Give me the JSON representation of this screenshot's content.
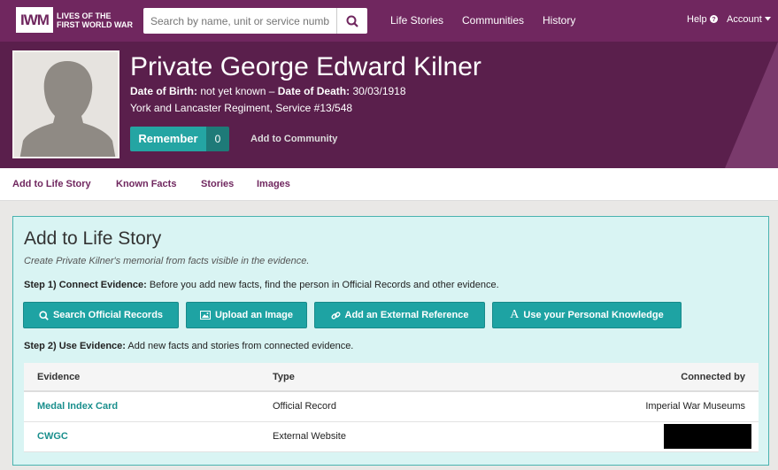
{
  "nav": {
    "logo_mark": "IWM",
    "logo_text": "LIVES OF THE FIRST WORLD WAR",
    "search_placeholder": "Search by name, unit or service number",
    "links": [
      "Life Stories",
      "Communities",
      "History"
    ],
    "help": "Help",
    "account": "Account"
  },
  "profile": {
    "rank": "Private",
    "name": "George Edward Kilner",
    "dob_label": "Date of Birth:",
    "dob_value": "not yet known",
    "dash": "–",
    "dod_label": "Date of Death:",
    "dod_value": "30/03/1918",
    "regiment": "York and Lancaster Regiment, Service #13/548",
    "remember_label": "Remember",
    "remember_count": "0",
    "add_community": "Add to Community"
  },
  "tabs": [
    "Add to Life Story",
    "Known Facts",
    "Stories",
    "Images"
  ],
  "panel": {
    "title": "Add to Life Story",
    "subtitle": "Create Private Kilner's memorial from facts visible in the evidence.",
    "step1_label": "Step 1) Connect Evidence:",
    "step1_text": "Before you add new facts, find the person in Official Records and other evidence.",
    "buttons": [
      {
        "label": "Search Official Records",
        "icon": "search-icon"
      },
      {
        "label": "Upload an Image",
        "icon": "image-icon"
      },
      {
        "label": "Add an External Reference",
        "icon": "link-icon"
      },
      {
        "label": "Use your Personal Knowledge",
        "icon": "font-icon"
      }
    ],
    "step2_label": "Step 2) Use Evidence:",
    "step2_text": "Add new facts and stories from connected evidence."
  },
  "table": {
    "headers": [
      "Evidence",
      "Type",
      "Connected by"
    ],
    "rows": [
      {
        "evidence": "Medal Index Card",
        "type": "Official Record",
        "connected_by": "Imperial War Museums"
      },
      {
        "evidence": "CWGC",
        "type": "External Website",
        "connected_by": ""
      }
    ]
  },
  "colors": {
    "brand": "#70275f",
    "hero": "#5a1f4c",
    "accent": "#24a5a3",
    "panel_bg": "#d9f4f3"
  }
}
